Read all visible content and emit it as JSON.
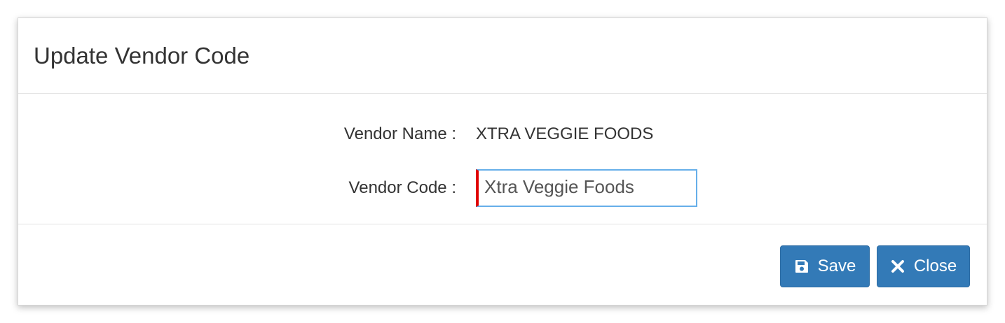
{
  "modal": {
    "title": "Update Vendor Code"
  },
  "form": {
    "vendor_name_label": "Vendor Name :",
    "vendor_name_value": "XTRA VEGGIE FOODS",
    "vendor_code_label": "Vendor Code :",
    "vendor_code_value": "Xtra Veggie Foods"
  },
  "footer": {
    "save_label": "Save",
    "save_icon": "floppy-disk-icon",
    "close_label": "Close",
    "close_icon": "times-icon"
  },
  "colors": {
    "primary_button": "#337ab7",
    "input_focus_border": "#66afe9",
    "required_indicator": "#e00000"
  }
}
